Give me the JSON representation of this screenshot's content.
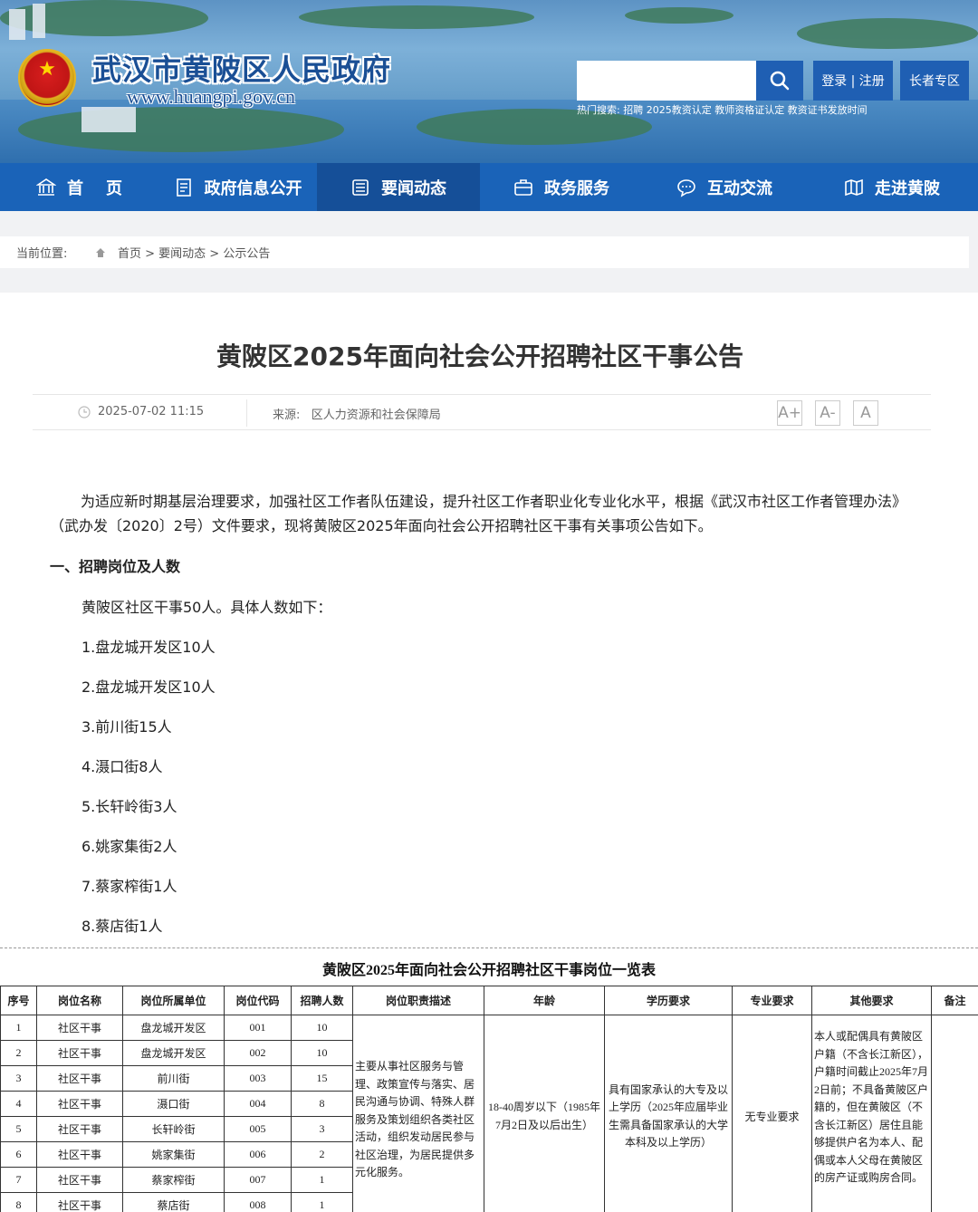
{
  "header": {
    "site_title": "武汉市黄陂区人民政府",
    "site_url": "www.huangpi.gov.cn",
    "search_placeholder": "",
    "login_label": "登录 | 注册",
    "elder_label": "长者专区",
    "hot_search": "热门搜索:  招聘  2025教资认定  教师资格证认定  教资证书发放时间"
  },
  "nav": {
    "items": [
      {
        "label": "首    页",
        "icon": "bank-icon"
      },
      {
        "label": "政府信息公开",
        "icon": "document-list-icon"
      },
      {
        "label": "要闻动态",
        "icon": "news-icon",
        "active": true
      },
      {
        "label": "政务服务",
        "icon": "briefcase-icon"
      },
      {
        "label": "互动交流",
        "icon": "chat-bubble-icon"
      },
      {
        "label": "走进黄陂",
        "icon": "map-book-icon"
      }
    ]
  },
  "breadcrumb": {
    "label": "当前位置:",
    "path": "首页 > 要闻动态 > 公示公告"
  },
  "article": {
    "title": "黄陂区2025年面向社会公开招聘社区干事公告",
    "date": "2025-07-02 11:15",
    "source": "来源:   区人力资源和社会保障局",
    "font_sizes": [
      "A+",
      "A-",
      "A"
    ],
    "intro": "为适应新时期基层治理要求，加强社区工作者队伍建设，提升社区工作者职业化专业化水平，根据《武汉市社区工作者管理办法》（武办发〔2020〕2号）文件要求，现将黄陂区2025年面向社会公开招聘社区干事有关事项公告如下。",
    "section1": "一、招聘岗位及人数",
    "summary": "黄陂区社区干事50人。具体人数如下：",
    "list": [
      "1.盘龙城开发区10人",
      "2.盘龙城开发区10人",
      "3.前川街15人",
      "4.滠口街8人",
      "5.长轩岭街3人",
      "6.姚家集街2人",
      "7.蔡家榨街1人",
      "8.蔡店街1人"
    ]
  },
  "table": {
    "title": "黄陂区2025年面向社会公开招聘社区干事岗位一览表",
    "headers": [
      "序号",
      "岗位名称",
      "岗位所属单位",
      "岗位代码",
      "招聘人数",
      "岗位职责描述",
      "年龄",
      "学历要求",
      "专业要求",
      "其他要求",
      "备注"
    ],
    "rows": [
      [
        "1",
        "社区干事",
        "盘龙城开发区",
        "001",
        "10"
      ],
      [
        "2",
        "社区干事",
        "盘龙城开发区",
        "002",
        "10"
      ],
      [
        "3",
        "社区干事",
        "前川街",
        "003",
        "15"
      ],
      [
        "4",
        "社区干事",
        "滠口街",
        "004",
        "8"
      ],
      [
        "5",
        "社区干事",
        "长轩岭街",
        "005",
        "3"
      ],
      [
        "6",
        "社区干事",
        "姚家集街",
        "006",
        "2"
      ],
      [
        "7",
        "社区干事",
        "蔡家榨街",
        "007",
        "1"
      ],
      [
        "8",
        "社区干事",
        "蔡店街",
        "008",
        "1"
      ]
    ],
    "duty": "主要从事社区服务与管理、政策宣传与落实、居民沟通与协调、特殊人群服务及策划组织各类社区活动，组织发动居民参与社区治理，为居民提供多元化服务。",
    "age": "18-40周岁以下（1985年7月2日及以后出生）",
    "education": "具有国家承认的大专及以上学历（2025年应届毕业生需具备国家承认的大学本科及以上学历）",
    "major": "无专业要求",
    "other": "本人或配偶具有黄陂区户籍（不含长江新区），户籍时间截止2025年7月2日前；不具备黄陂区户籍的，但在黄陂区（不含长江新区）居住且能够提供户名为本人、配偶或本人父母在黄陂区的房产证或购房合同。",
    "remark": ""
  }
}
